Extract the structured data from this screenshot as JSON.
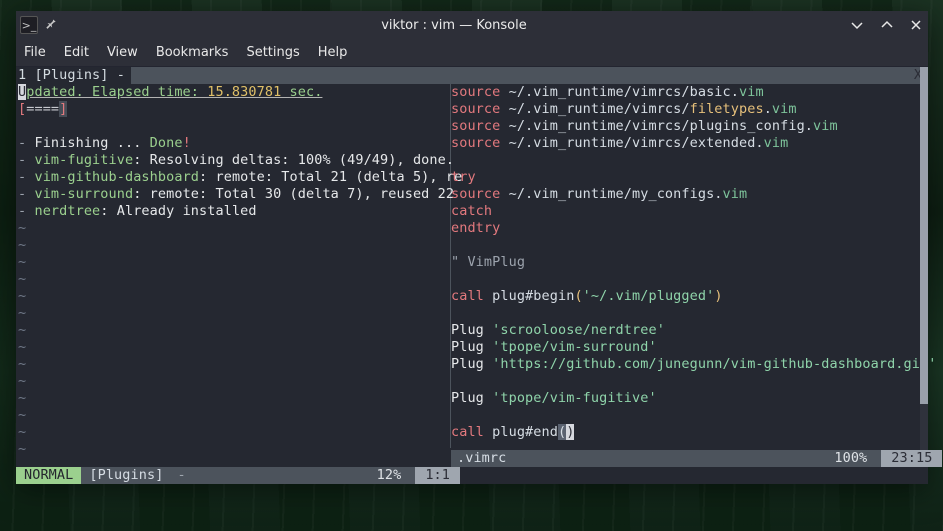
{
  "window": {
    "title": "viktor : vim — Konsole"
  },
  "menu": [
    "File",
    "Edit",
    "View",
    "Bookmarks",
    "Settings",
    "Help"
  ],
  "tabbar": {
    "label": "1 [Plugins] -",
    "close_glyph": "X"
  },
  "left": {
    "updated_prefix": "pdated. Elapsed time:",
    "elapsed": " 15.830781 ",
    "sec": "sec.",
    "progress": "====",
    "finishing_prefix": "Finishing ... ",
    "finishing_done": "Done",
    "items": [
      {
        "name": "vim-fugitive",
        "rest": ": Resolving deltas: 100% (49/49), done."
      },
      {
        "name": "vim-github-dashboard",
        "rest": ": remote: Total 21 (delta 5), re"
      },
      {
        "name": "vim-surround",
        "rest": ": remote: Total 30 (delta 7), reused 22"
      },
      {
        "name": "nerdtree",
        "rest": ": Already installed"
      }
    ],
    "status": {
      "mode": "NORMAL",
      "file": "[Plugins]",
      "dash": "-",
      "pct": "12%",
      "pos": "1:1"
    }
  },
  "right_lines": [
    [
      {
        "c": "kw",
        "t": "source"
      },
      {
        "c": "path",
        "t": " ~/.vim_runtime/vimrcs/basic."
      },
      {
        "c": "str",
        "t": "vim"
      }
    ],
    [
      {
        "c": "kw",
        "t": "source"
      },
      {
        "c": "path",
        "t": " ~/.vim_runtime/vimrcs/"
      },
      {
        "c": "yellow",
        "t": "filetypes"
      },
      {
        "c": "path",
        "t": "."
      },
      {
        "c": "str",
        "t": "vim"
      }
    ],
    [
      {
        "c": "kw",
        "t": "source"
      },
      {
        "c": "path",
        "t": " ~/.vim_runtime/vimrcs/plugins_config."
      },
      {
        "c": "str",
        "t": "vim"
      }
    ],
    [
      {
        "c": "kw",
        "t": "source"
      },
      {
        "c": "path",
        "t": " ~/.vim_runtime/vimrcs/extended."
      },
      {
        "c": "str",
        "t": "vim"
      }
    ],
    [],
    [
      {
        "c": "kw",
        "t": "try"
      }
    ],
    [
      {
        "c": "kw",
        "t": "source"
      },
      {
        "c": "path",
        "t": " ~/.vim_runtime/my_configs."
      },
      {
        "c": "str",
        "t": "vim"
      }
    ],
    [
      {
        "c": "kw",
        "t": "catch"
      }
    ],
    [
      {
        "c": "kw",
        "t": "endtry"
      }
    ],
    [],
    [
      {
        "c": "dim",
        "t": "\" VimPlug"
      }
    ],
    [],
    [
      {
        "c": "kw",
        "t": "call"
      },
      {
        "c": "path",
        "t": " plug#begin"
      },
      {
        "c": "yellow",
        "t": "("
      },
      {
        "c": "str2",
        "t": "'~/.vim/plugged'"
      },
      {
        "c": "yellow",
        "t": ")"
      }
    ],
    [],
    [
      {
        "c": "white",
        "t": "Plug "
      },
      {
        "c": "str2",
        "t": "'scrooloose/nerdtree'"
      }
    ],
    [
      {
        "c": "white",
        "t": "Plug "
      },
      {
        "c": "str2",
        "t": "'tpope/vim-surround'"
      }
    ],
    [
      {
        "c": "white",
        "t": "Plug "
      },
      {
        "c": "str2",
        "t": "'https://github.com/junegunn/vim-github-dashboard.git'"
      }
    ],
    [],
    [
      {
        "c": "white",
        "t": "Plug "
      },
      {
        "c": "str2",
        "t": "'tpope/vim-fugitive'"
      }
    ],
    [],
    [
      {
        "c": "kw",
        "t": "call"
      },
      {
        "c": "path",
        "t": " plug#end"
      },
      {
        "c": "paren-match",
        "t": "("
      },
      {
        "c": "cursor-u",
        "t": ")"
      }
    ]
  ],
  "right_status": {
    "file": ".vimrc",
    "pct": "100%",
    "pos": "23:15"
  }
}
